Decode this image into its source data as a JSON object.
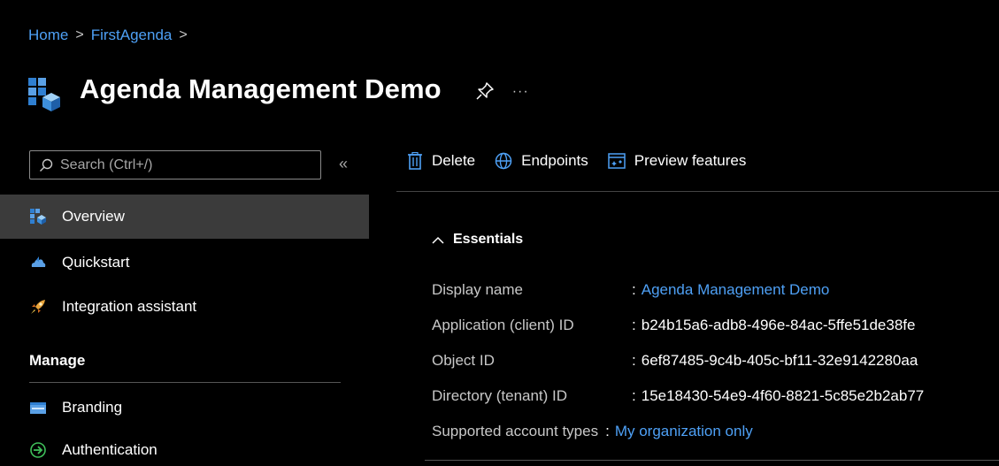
{
  "breadcrumb": {
    "home": "Home",
    "current": "FirstAgenda",
    "sep": ">"
  },
  "header": {
    "title": "Agenda Management Demo",
    "more": "···"
  },
  "sidebar": {
    "search_placeholder": "Search (Ctrl+/)",
    "collapse": "«",
    "items": [
      {
        "label": "Overview",
        "icon": "app-registration-icon",
        "active": true
      },
      {
        "label": "Quickstart",
        "icon": "quickstart-cloud-icon"
      },
      {
        "label": "Integration assistant",
        "icon": "rocket-icon"
      }
    ],
    "manage_heading": "Manage",
    "manage_items": [
      {
        "label": "Branding",
        "icon": "branding-icon"
      },
      {
        "label": "Authentication",
        "icon": "authentication-icon"
      }
    ]
  },
  "toolbar": {
    "delete": "Delete",
    "endpoints": "Endpoints",
    "preview": "Preview features"
  },
  "essentials": {
    "heading": "Essentials",
    "rows": [
      {
        "label": "Display name",
        "value": "Agenda Management Demo",
        "link": true
      },
      {
        "label": "Application (client) ID",
        "value": "b24b15a6-adb8-496e-84ac-5ffe51de38fe",
        "link": false
      },
      {
        "label": "Object ID",
        "value": "6ef87485-9c4b-405c-bf11-32e9142280aa",
        "link": false
      },
      {
        "label": "Directory (tenant) ID",
        "value": "15e18430-54e9-4f60-8821-5c85e2b2ab77",
        "link": false
      },
      {
        "label": "Supported account types",
        "value": "My organization only",
        "link": true
      }
    ],
    "separator": ":"
  },
  "colors": {
    "accent": "#4ea0f5",
    "background": "#000000",
    "active_nav": "#3b3b3b"
  }
}
